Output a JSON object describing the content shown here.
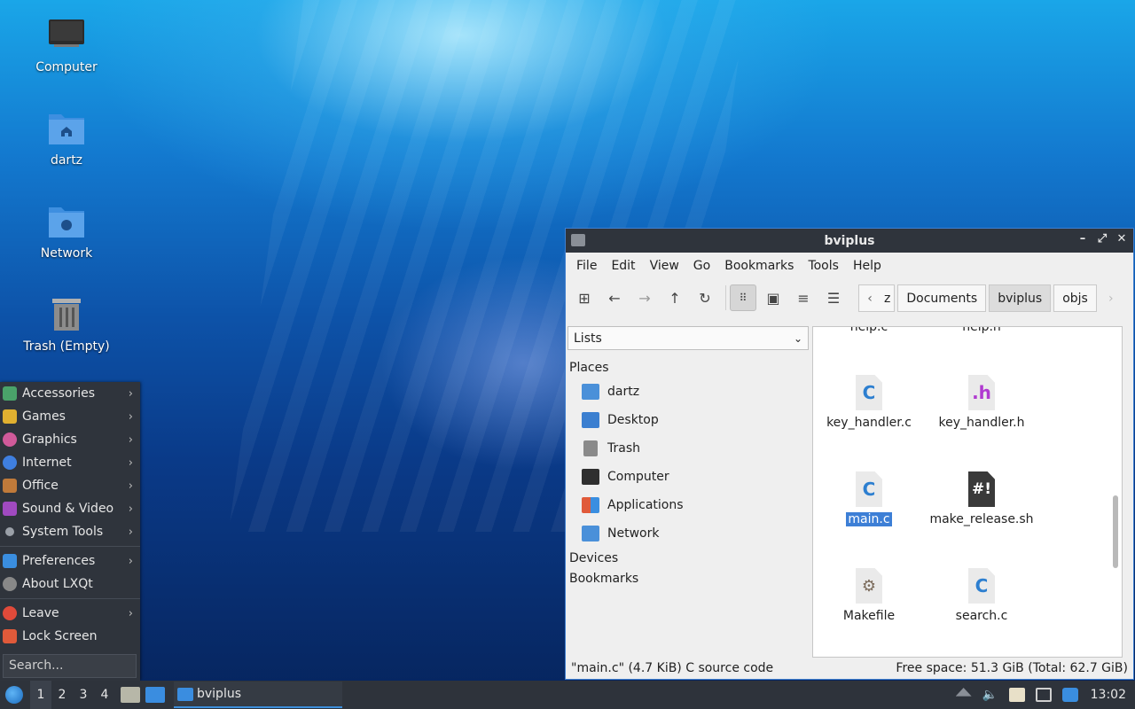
{
  "desktop": {
    "icons": [
      {
        "label": "Computer"
      },
      {
        "label": "dartz"
      },
      {
        "label": "Network"
      },
      {
        "label": "Trash (Empty)"
      }
    ]
  },
  "startmenu": {
    "items": [
      {
        "label": "Accessories",
        "icon": "accessories-icon",
        "color": "#4aa36a"
      },
      {
        "label": "Games",
        "icon": "games-icon",
        "color": "#e0b030"
      },
      {
        "label": "Graphics",
        "icon": "graphics-icon",
        "color": "#d05a9a"
      },
      {
        "label": "Internet",
        "icon": "internet-icon",
        "color": "#3f7fe0"
      },
      {
        "label": "Office",
        "icon": "office-icon",
        "color": "#c07a3a"
      },
      {
        "label": "Sound & Video",
        "icon": "sound-video-icon",
        "color": "#a04ac0"
      },
      {
        "label": "System Tools",
        "icon": "system-tools-icon",
        "color": "#9aa0a8"
      },
      {
        "label": "Preferences",
        "icon": "preferences-icon",
        "color": "#3a8ee0"
      },
      {
        "label": "About LXQt",
        "icon": "info-icon",
        "color": "#888888"
      },
      {
        "label": "Leave",
        "icon": "power-icon",
        "color": "#e04a3a"
      },
      {
        "label": "Lock Screen",
        "icon": "lock-icon",
        "color": "#e05a3a"
      }
    ],
    "search_placeholder": "Search..."
  },
  "taskbar": {
    "desktops": [
      "1",
      "2",
      "3",
      "4"
    ],
    "task_label": "bviplus",
    "clock": "13:02"
  },
  "window": {
    "title": "bviplus",
    "menu": [
      "File",
      "Edit",
      "View",
      "Go",
      "Bookmarks",
      "Tools",
      "Help"
    ],
    "breadcrumb": [
      "z",
      "Documents",
      "bviplus",
      "objs"
    ],
    "side_select": "Lists",
    "places_heading": "Places",
    "places": [
      {
        "label": "dartz",
        "color": "#4a90d9"
      },
      {
        "label": "Desktop",
        "color": "#3b7fd0"
      },
      {
        "label": "Trash",
        "color": "#8a8a8a"
      },
      {
        "label": "Computer",
        "color": "#2f2f2f"
      },
      {
        "label": "Applications",
        "color": "#e05a3a"
      },
      {
        "label": "Network",
        "color": "#4a90d9"
      }
    ],
    "devices_heading": "Devices",
    "bookmarks_heading": "Bookmarks",
    "files": {
      "partial_top": [
        "help.c",
        "help.h"
      ],
      "row1": [
        {
          "label": "key_handler.c",
          "glyph": "C"
        },
        {
          "label": "key_handler.h",
          "glyph": ".h"
        }
      ],
      "row2": [
        {
          "label": "main.c",
          "glyph": "C"
        },
        {
          "label": "make_release.sh",
          "glyph": "#!"
        }
      ],
      "row3": [
        {
          "label": "Makefile",
          "glyph": "⚙"
        },
        {
          "label": "search.c",
          "glyph": "C"
        }
      ]
    },
    "status_left": "\"main.c\" (4.7 KiB) C source code",
    "status_right": "Free space: 51.3 GiB (Total: 62.7 GiB)"
  }
}
